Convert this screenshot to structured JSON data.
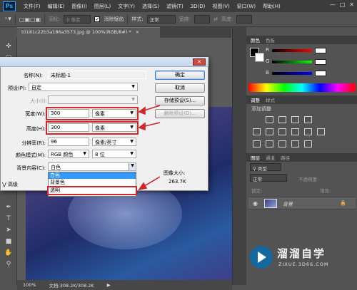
{
  "app": {
    "logo": "Ps"
  },
  "menu": [
    "文件(F)",
    "编辑(E)",
    "图像(I)",
    "图层(L)",
    "文字(Y)",
    "选择(S)",
    "滤镜(T)",
    "3D(D)",
    "视图(V)",
    "窗口(W)",
    "帮助(H)"
  ],
  "options_bar": {
    "feather_label": "羽化:",
    "feather_value": "0 像素",
    "antialias_label": "消除锯齿",
    "style_label": "样式:",
    "style_value": "正常",
    "width_label": "宽度:",
    "height_label": "高度:"
  },
  "document_tab": {
    "title": "t0181c22b3a186a3573.jpg @ 100%(RGB/8#) *",
    "close": "×"
  },
  "status_bar": {
    "zoom": "100%",
    "doc_size": "文档:308.2K/308.2K"
  },
  "dialog": {
    "name_label": "名称(N):",
    "name_value": "未标题-1",
    "preset_label": "预设(P):",
    "preset_value": "自定",
    "size_label": "大小(I):",
    "width_label": "宽度(W):",
    "width_value": "300",
    "width_unit": "像素",
    "height_label": "高度(H):",
    "height_value": "300",
    "height_unit": "像素",
    "resolution_label": "分辨率(R):",
    "resolution_value": "96",
    "resolution_unit": "像素/英寸",
    "color_mode_label": "颜色模式(M):",
    "color_mode_value": "RGB 颜色",
    "bit_depth": "8 位",
    "bg_label": "背景内容(C):",
    "bg_value": "白色",
    "bg_options": [
      "白色",
      "背景色",
      "透明"
    ],
    "advanced_label": "高级",
    "ok_button": "确定",
    "cancel_button": "取消",
    "save_preset_button": "存储预设(S)...",
    "delete_preset_button": "删除预设(D)...",
    "image_size_label": "图像大小:",
    "image_size_value": "263.7K"
  },
  "panels": {
    "color_tabs": [
      "颜色",
      "色板"
    ],
    "color_labels": [
      "R",
      "G",
      "B"
    ],
    "adjust_tabs": [
      "调整",
      "样式"
    ],
    "adjust_title": "添加调整",
    "layers_tabs": [
      "图层",
      "通道",
      "路径"
    ],
    "kind_filter": "类型",
    "blend_mode": "正常",
    "opacity_label": "不透明度:",
    "lock_label": "锁定:",
    "fill_label": "填充:",
    "layer_name": "背景"
  },
  "watermark": {
    "title": "溜溜自学",
    "url": "ZIXUE.3D66.COM"
  },
  "colors": {
    "accent_red": "#d0262c",
    "selection_blue": "#3399ff",
    "ps_blue": "#31a8ff"
  }
}
